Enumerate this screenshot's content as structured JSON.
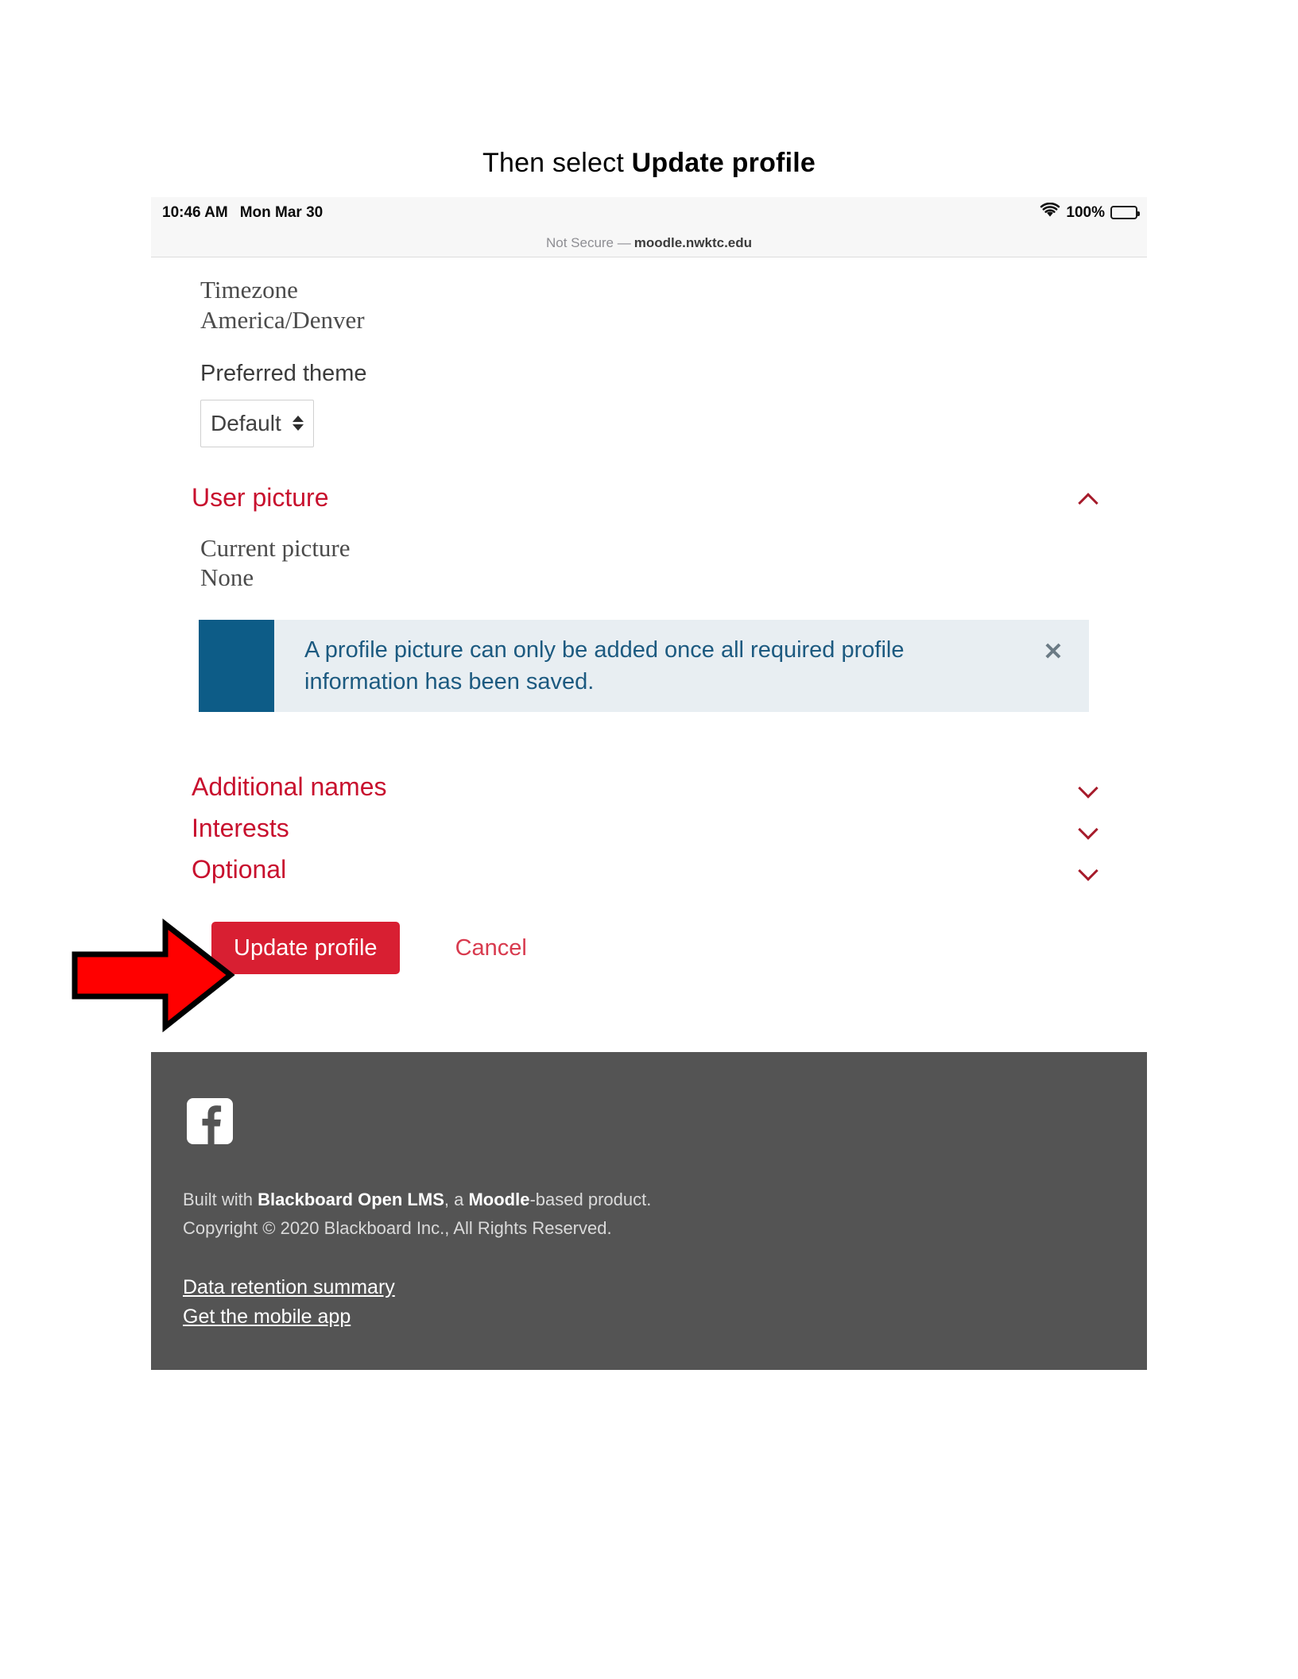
{
  "instruction": {
    "prefix": "Then select ",
    "emphasis": "Update profile"
  },
  "statusbar": {
    "time": "10:46 AM",
    "date": "Mon Mar 30",
    "battery_percent": "100%",
    "wifi_icon": "wifi-icon",
    "battery_icon": "battery-full-icon"
  },
  "urlbar": {
    "security_label": "Not Secure —",
    "host": "moodle.nwktc.edu"
  },
  "form": {
    "timezone_label": "Timezone",
    "timezone_value": "America/Denver",
    "theme_label": "Preferred theme",
    "theme_selected": "Default",
    "theme_options": [
      "Default"
    ]
  },
  "sections": [
    {
      "title": "User picture",
      "expanded": true,
      "chevron": "chevron-up-icon"
    },
    {
      "title": "Additional names",
      "expanded": false,
      "chevron": "chevron-down-icon"
    },
    {
      "title": "Interests",
      "expanded": false,
      "chevron": "chevron-down-icon"
    },
    {
      "title": "Optional",
      "expanded": false,
      "chevron": "chevron-down-icon"
    }
  ],
  "user_picture": {
    "current_label": "Current picture",
    "current_value": "None"
  },
  "alert": {
    "message": "A profile picture can only be added once all required profile information has been saved.",
    "close_icon": "close-icon",
    "accent_color": "#0d5c87",
    "background_color": "#e8eef2",
    "text_color": "#1c5a80"
  },
  "actions": {
    "submit_label": "Update profile",
    "cancel_label": "Cancel",
    "submit_color": "#d81f32"
  },
  "annotation": {
    "arrow_color": "#ff0000",
    "arrow_outline": "#000000",
    "points_to": "Update profile"
  },
  "footer": {
    "facebook_icon": "facebook-icon",
    "built_with_prefix": "Built with ",
    "built_with_brand": "Blackboard Open LMS",
    "built_with_mid": ", a ",
    "built_with_product": "Moodle",
    "built_with_suffix": "-based product.",
    "copyright": "Copyright © 2020 Blackboard Inc., All Rights Reserved.",
    "links": [
      "Data retention summary",
      "Get the mobile app"
    ],
    "background_color": "#545454"
  }
}
